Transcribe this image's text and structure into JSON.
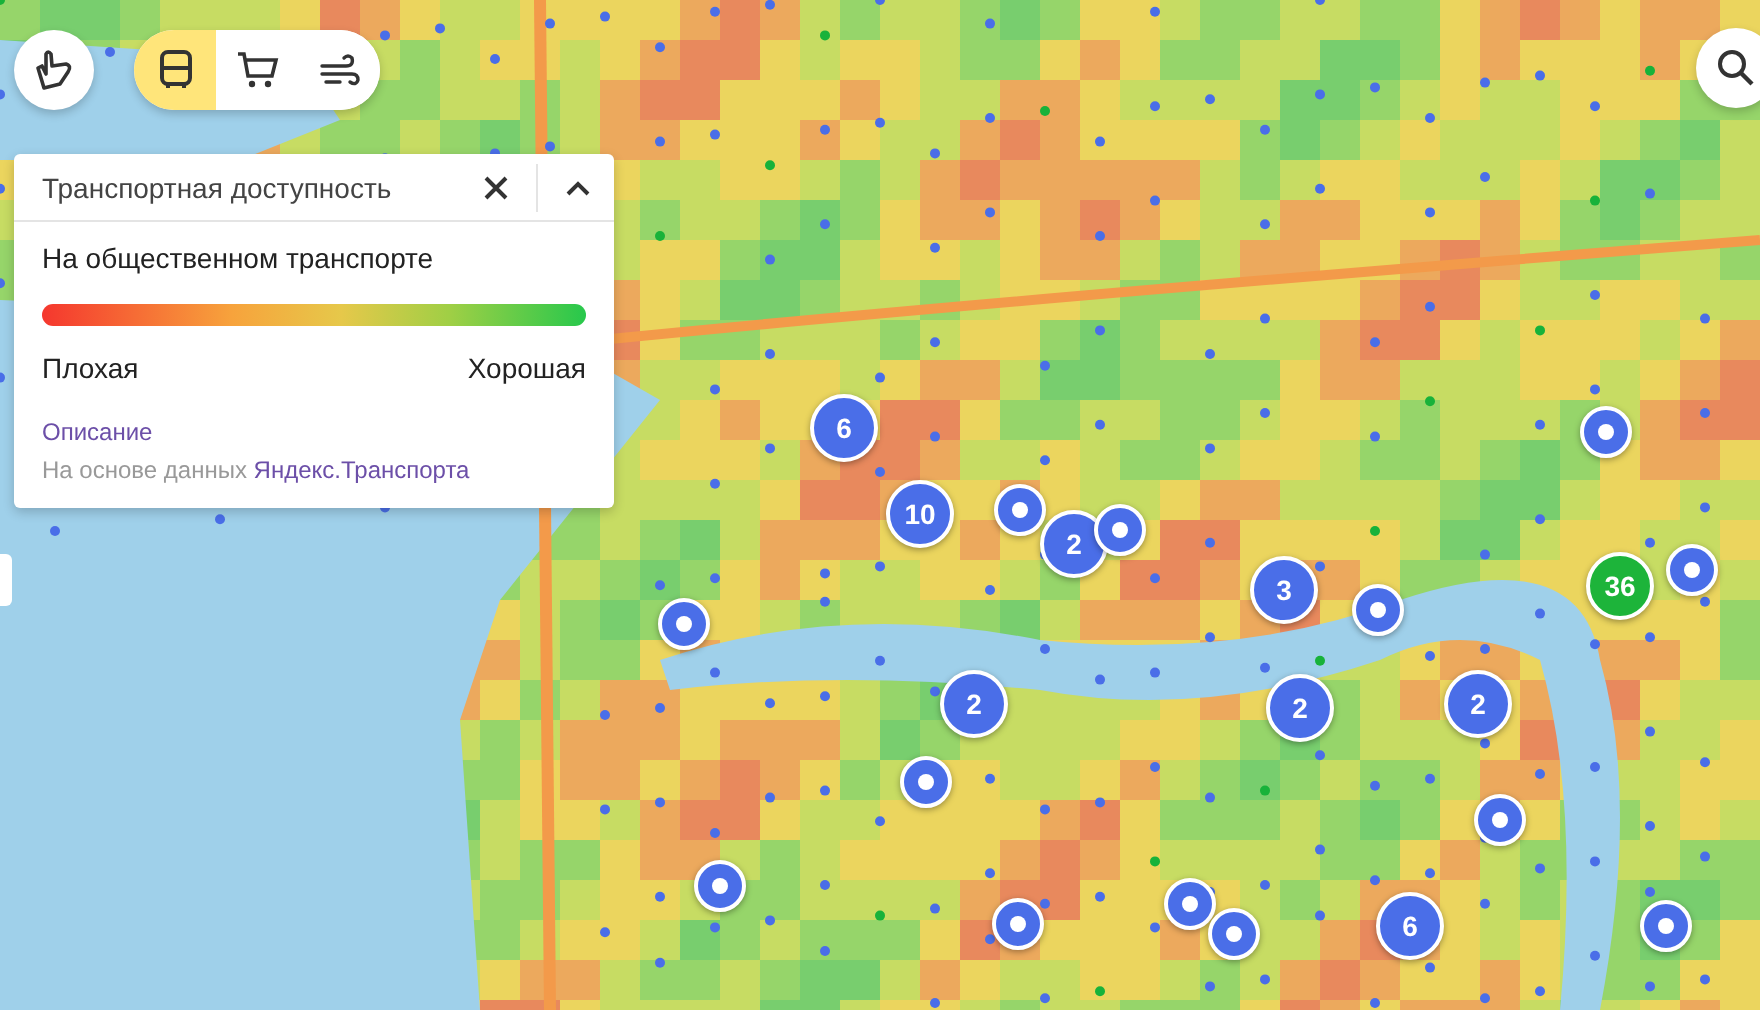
{
  "toolbar": {
    "modes": [
      {
        "kind": "bus",
        "selected": true
      },
      {
        "kind": "cart",
        "selected": false
      },
      {
        "kind": "wind",
        "selected": false
      }
    ]
  },
  "panel": {
    "title": "Транспортная доступность",
    "subtitle": "На общественном транспорте",
    "scale_low": "Плохая",
    "scale_high": "Хорошая",
    "link": "Описание",
    "source_prefix": "На основе данных",
    "source_link": "Яндекс.Транспорта"
  },
  "pins": [
    {
      "kind": "cluster",
      "label": "6",
      "color": "#4a6ee8"
    },
    {
      "kind": "cluster",
      "label": "10",
      "color": "#4a6ee8"
    },
    {
      "kind": "point",
      "color": "#4a6ee8"
    },
    {
      "kind": "cluster",
      "label": "2",
      "color": "#4a6ee8"
    },
    {
      "kind": "point",
      "color": "#4a6ee8"
    },
    {
      "kind": "cluster",
      "label": "3",
      "color": "#4a6ee8"
    },
    {
      "kind": "point",
      "color": "#4a6ee8"
    },
    {
      "kind": "cluster",
      "label": "36",
      "color": "#1db43a"
    },
    {
      "kind": "point",
      "color": "#4a6ee8"
    },
    {
      "kind": "point",
      "color": "#4a6ee8"
    },
    {
      "kind": "point",
      "color": "#4a6ee8"
    },
    {
      "kind": "cluster",
      "label": "2",
      "color": "#4a6ee8"
    },
    {
      "kind": "cluster",
      "label": "2",
      "color": "#4a6ee8"
    },
    {
      "kind": "cluster",
      "label": "2",
      "color": "#4a6ee8"
    },
    {
      "kind": "point",
      "color": "#4a6ee8"
    },
    {
      "kind": "point",
      "color": "#4a6ee8"
    },
    {
      "kind": "point",
      "color": "#4a6ee8"
    },
    {
      "kind": "point",
      "color": "#4a6ee8"
    },
    {
      "kind": "point",
      "color": "#4a6ee8"
    },
    {
      "kind": "point",
      "color": "#4a6ee8"
    },
    {
      "kind": "cluster",
      "label": "6",
      "color": "#4a6ee8"
    },
    {
      "kind": "point",
      "color": "#4a6ee8"
    }
  ]
}
